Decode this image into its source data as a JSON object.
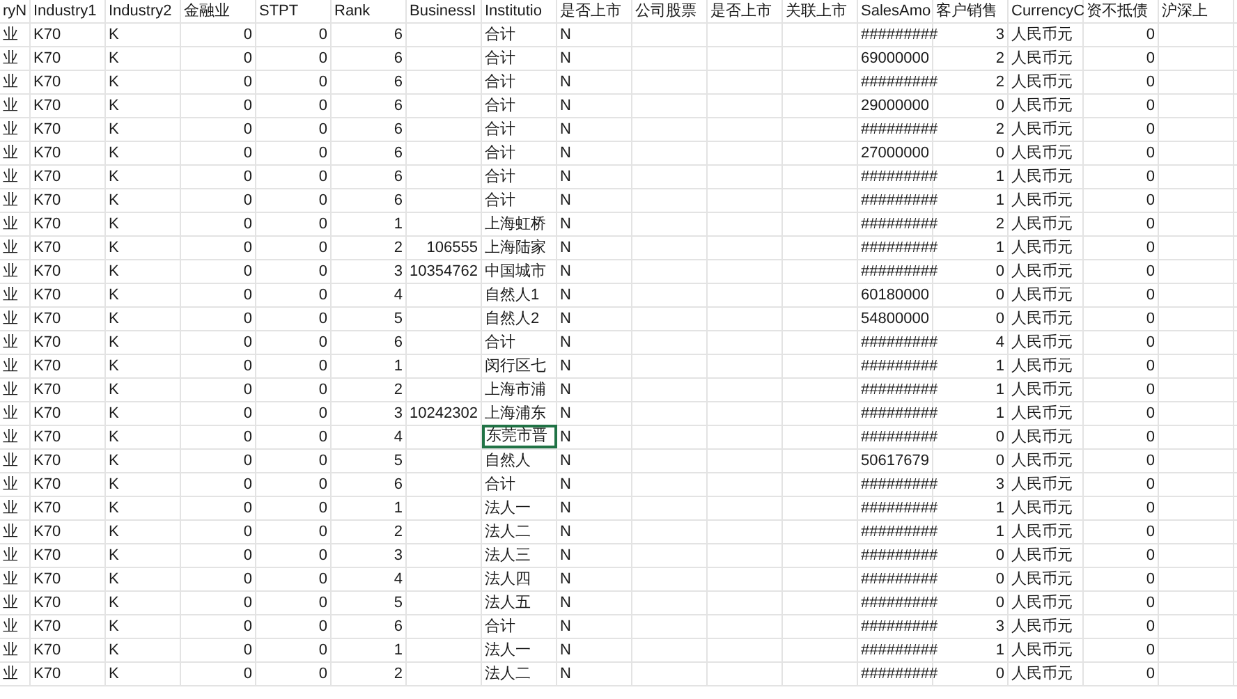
{
  "sheet": {
    "columns": [
      {
        "header": "ryN",
        "kind": "text",
        "selected": false
      },
      {
        "header": "Industry1",
        "kind": "text",
        "selected": false
      },
      {
        "header": "Industry2",
        "kind": "text",
        "selected": false
      },
      {
        "header": "金融业",
        "kind": "number",
        "selected": false
      },
      {
        "header": "STPT",
        "kind": "number",
        "selected": false
      },
      {
        "header": "Rank",
        "kind": "number",
        "selected": false
      },
      {
        "header": "BusinessI",
        "kind": "number",
        "selected": false
      },
      {
        "header": "Institutio",
        "kind": "text",
        "selected": true
      },
      {
        "header": "是否上市",
        "kind": "text",
        "selected": false
      },
      {
        "header": "公司股票",
        "selected": false
      },
      {
        "header": "是否上市",
        "selected": false
      },
      {
        "header": "关联上市",
        "selected": false
      },
      {
        "header": "SalesAmo",
        "kind": "number",
        "selected": false
      },
      {
        "header": "客户销售",
        "kind": "number",
        "selected": false
      },
      {
        "header": "CurrencyC",
        "kind": "text",
        "selected": false
      },
      {
        "header": "资不抵债",
        "kind": "number",
        "selected": false
      },
      {
        "header": "沪深上",
        "selected": false
      }
    ],
    "rows": [
      {
        "selected": false,
        "cells": [
          "业",
          "K70",
          "K",
          "0",
          "0",
          "6",
          null,
          "合计",
          "N",
          null,
          null,
          null,
          "#########",
          "3",
          "人民币元",
          "0",
          null
        ]
      },
      {
        "selected": false,
        "cells": [
          "业",
          "K70",
          "K",
          "0",
          "0",
          "6",
          null,
          "合计",
          "N",
          null,
          null,
          null,
          "69000000",
          "2",
          "人民币元",
          "0",
          null
        ]
      },
      {
        "selected": false,
        "cells": [
          "业",
          "K70",
          "K",
          "0",
          "0",
          "6",
          null,
          "合计",
          "N",
          null,
          null,
          null,
          "#########",
          "2",
          "人民币元",
          "0",
          null
        ]
      },
      {
        "selected": false,
        "cells": [
          "业",
          "K70",
          "K",
          "0",
          "0",
          "6",
          null,
          "合计",
          "N",
          null,
          null,
          null,
          "29000000",
          "0",
          "人民币元",
          "0",
          null
        ]
      },
      {
        "selected": false,
        "cells": [
          "业",
          "K70",
          "K",
          "0",
          "0",
          "6",
          null,
          "合计",
          "N",
          null,
          null,
          null,
          "#########",
          "2",
          "人民币元",
          "0",
          null
        ]
      },
      {
        "selected": false,
        "cells": [
          "业",
          "K70",
          "K",
          "0",
          "0",
          "6",
          null,
          "合计",
          "N",
          null,
          null,
          null,
          "27000000",
          "0",
          "人民币元",
          "0",
          null
        ]
      },
      {
        "selected": false,
        "cells": [
          "业",
          "K70",
          "K",
          "0",
          "0",
          "6",
          null,
          "合计",
          "N",
          null,
          null,
          null,
          "#########",
          "1",
          "人民币元",
          "0",
          null
        ]
      },
      {
        "selected": false,
        "cells": [
          "业",
          "K70",
          "K",
          "0",
          "0",
          "6",
          null,
          "合计",
          "N",
          null,
          null,
          null,
          "#########",
          "1",
          "人民币元",
          "0",
          null
        ]
      },
      {
        "selected": false,
        "cells": [
          "业",
          "K70",
          "K",
          "0",
          "0",
          "1",
          null,
          "上海虹桥",
          "N",
          null,
          null,
          null,
          "#########",
          "2",
          "人民币元",
          "0",
          null
        ]
      },
      {
        "selected": false,
        "cells": [
          "业",
          "K70",
          "K",
          "0",
          "0",
          "2",
          "106555",
          "上海陆家",
          "N",
          null,
          null,
          null,
          "#########",
          "1",
          "人民币元",
          "0",
          null
        ]
      },
      {
        "selected": false,
        "cells": [
          "业",
          "K70",
          "K",
          "0",
          "0",
          "3",
          "10354762",
          "中国城市",
          "N",
          null,
          null,
          null,
          "#########",
          "0",
          "人民币元",
          "0",
          null
        ]
      },
      {
        "selected": false,
        "cells": [
          "业",
          "K70",
          "K",
          "0",
          "0",
          "4",
          null,
          "自然人1",
          "N",
          null,
          null,
          null,
          "60180000",
          "0",
          "人民币元",
          "0",
          null
        ]
      },
      {
        "selected": false,
        "cells": [
          "业",
          "K70",
          "K",
          "0",
          "0",
          "5",
          null,
          "自然人2",
          "N",
          null,
          null,
          null,
          "54800000",
          "0",
          "人民币元",
          "0",
          null
        ]
      },
      {
        "selected": false,
        "cells": [
          "业",
          "K70",
          "K",
          "0",
          "0",
          "6",
          null,
          "合计",
          "N",
          null,
          null,
          null,
          "#########",
          "4",
          "人民币元",
          "0",
          null
        ]
      },
      {
        "selected": false,
        "cells": [
          "业",
          "K70",
          "K",
          "0",
          "0",
          "1",
          null,
          "闵行区七",
          "N",
          null,
          null,
          null,
          "#########",
          "1",
          "人民币元",
          "0",
          null
        ]
      },
      {
        "selected": false,
        "cells": [
          "业",
          "K70",
          "K",
          "0",
          "0",
          "2",
          null,
          "上海市浦",
          "N",
          null,
          null,
          null,
          "#########",
          "1",
          "人民币元",
          "0",
          null
        ]
      },
      {
        "selected": false,
        "cells": [
          "业",
          "K70",
          "K",
          "0",
          "0",
          "3",
          "10242302",
          "上海浦东",
          "N",
          null,
          null,
          null,
          "#########",
          "1",
          "人民币元",
          "0",
          null
        ]
      },
      {
        "selected": true,
        "cells": [
          "业",
          "K70",
          "K",
          "0",
          "0",
          "4",
          null,
          "东莞市晋",
          "N",
          null,
          null,
          null,
          "#########",
          "0",
          "人民币元",
          "0",
          null
        ]
      },
      {
        "selected": false,
        "cells": [
          "业",
          "K70",
          "K",
          "0",
          "0",
          "5",
          null,
          "自然人",
          "N",
          null,
          null,
          null,
          "50617679",
          "0",
          "人民币元",
          "0",
          null
        ]
      },
      {
        "selected": false,
        "cells": [
          "业",
          "K70",
          "K",
          "0",
          "0",
          "6",
          null,
          "合计",
          "N",
          null,
          null,
          null,
          "#########",
          "3",
          "人民币元",
          "0",
          null
        ]
      },
      {
        "selected": false,
        "cells": [
          "业",
          "K70",
          "K",
          "0",
          "0",
          "1",
          null,
          "法人一",
          "N",
          null,
          null,
          null,
          "#########",
          "1",
          "人民币元",
          "0",
          null
        ]
      },
      {
        "selected": false,
        "cells": [
          "业",
          "K70",
          "K",
          "0",
          "0",
          "2",
          null,
          "法人二",
          "N",
          null,
          null,
          null,
          "#########",
          "1",
          "人民币元",
          "0",
          null
        ]
      },
      {
        "selected": false,
        "cells": [
          "业",
          "K70",
          "K",
          "0",
          "0",
          "3",
          null,
          "法人三",
          "N",
          null,
          null,
          null,
          "#########",
          "0",
          "人民币元",
          "0",
          null
        ]
      },
      {
        "selected": false,
        "cells": [
          "业",
          "K70",
          "K",
          "0",
          "0",
          "4",
          null,
          "法人四",
          "N",
          null,
          null,
          null,
          "#########",
          "0",
          "人民币元",
          "0",
          null
        ]
      },
      {
        "selected": false,
        "cells": [
          "业",
          "K70",
          "K",
          "0",
          "0",
          "5",
          null,
          "法人五",
          "N",
          null,
          null,
          null,
          "#########",
          "0",
          "人民币元",
          "0",
          null
        ]
      },
      {
        "selected": false,
        "cells": [
          "业",
          "K70",
          "K",
          "0",
          "0",
          "6",
          null,
          "合计",
          "N",
          null,
          null,
          null,
          "#########",
          "3",
          "人民币元",
          "0",
          null
        ]
      },
      {
        "selected": false,
        "cells": [
          "业",
          "K70",
          "K",
          "0",
          "0",
          "1",
          null,
          "法人一",
          "N",
          null,
          null,
          null,
          "#########",
          "1",
          "人民币元",
          "0",
          null
        ]
      },
      {
        "selected": false,
        "cells": [
          "业",
          "K70",
          "K",
          "0",
          "0",
          "2",
          null,
          "法人二",
          "N",
          null,
          null,
          null,
          "#########",
          "0",
          "人民币元",
          "0",
          null
        ]
      }
    ]
  }
}
